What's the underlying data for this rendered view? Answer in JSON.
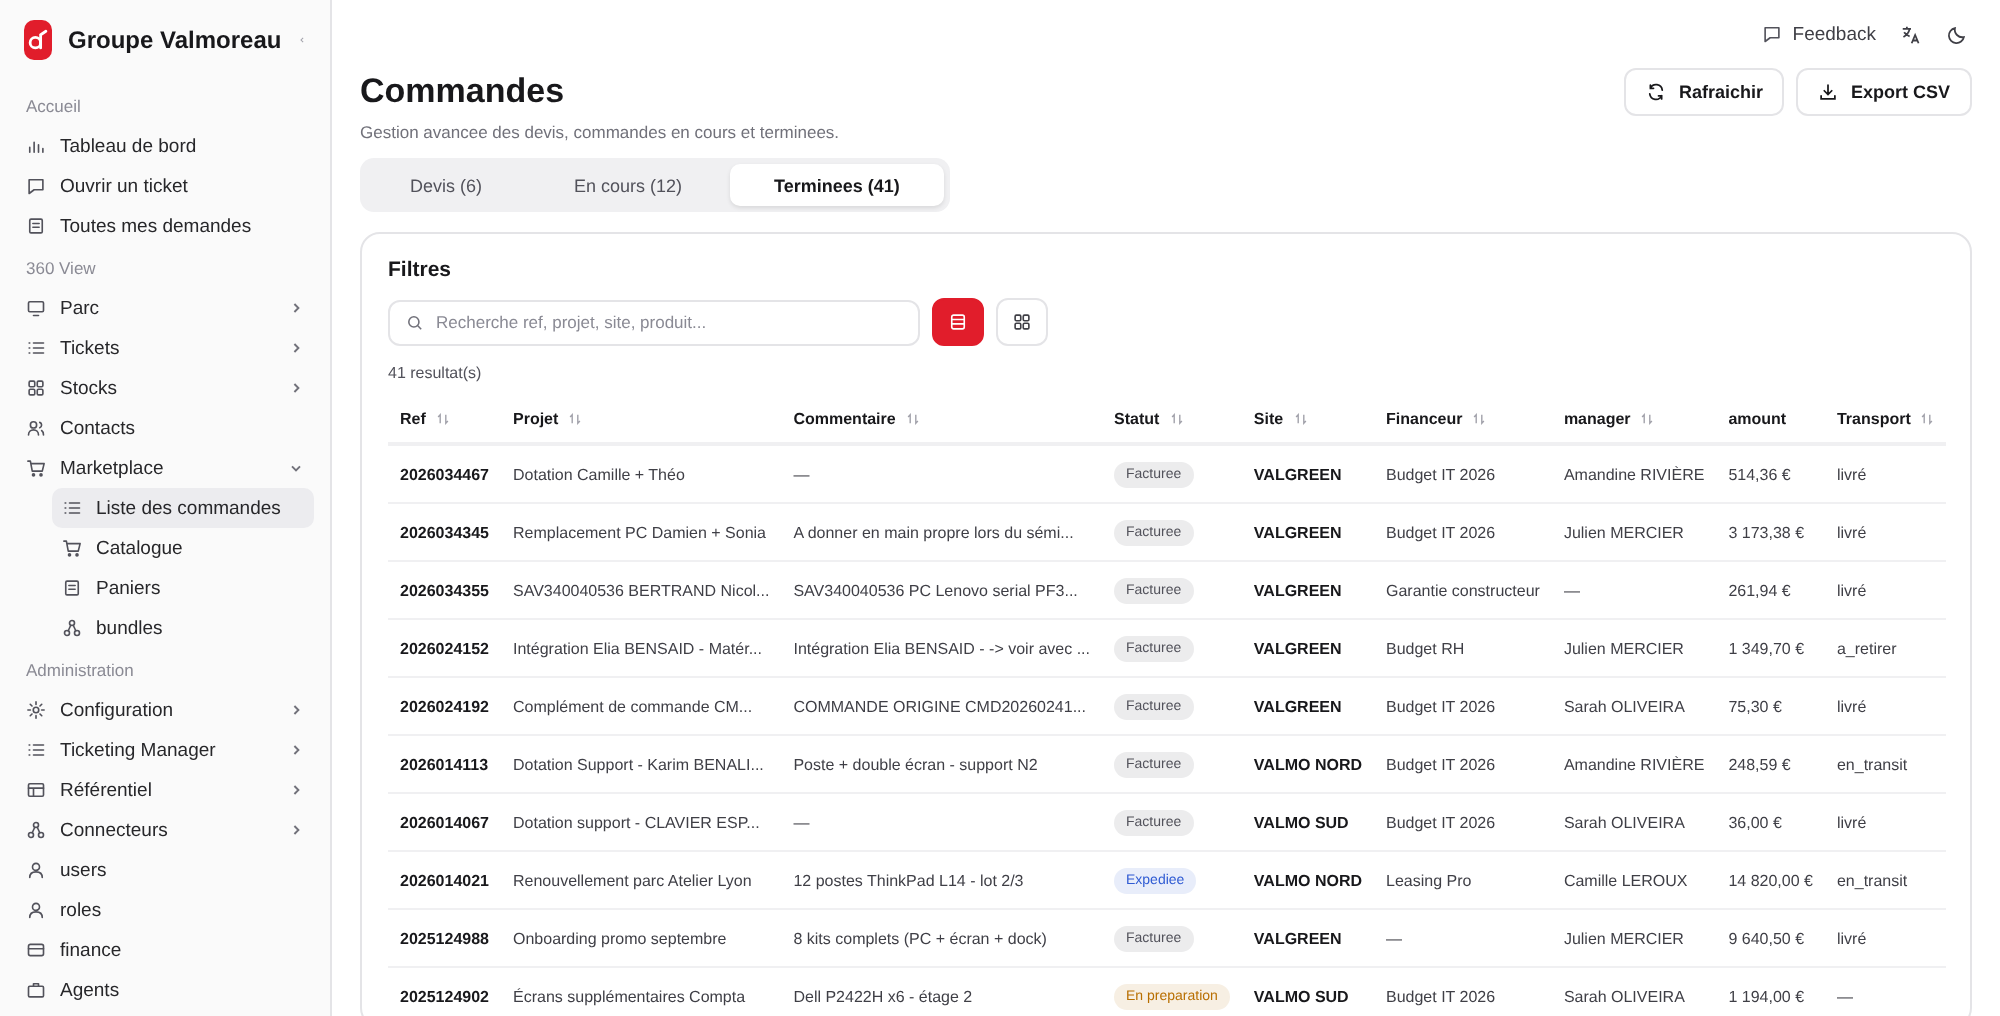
{
  "sidebar": {
    "brand": "Groupe Valmoreau",
    "sections": [
      {
        "title": "Accueil",
        "items": [
          {
            "label": "Tableau de bord",
            "kind": "chart",
            "selected": false
          },
          {
            "label": "Ouvrir un ticket",
            "kind": "message",
            "selected": false
          },
          {
            "label": "Toutes mes demandes",
            "kind": "doc",
            "selected": false
          }
        ]
      },
      {
        "title": "360 View",
        "items": [
          {
            "label": "Parc",
            "kind": "monitor",
            "selected": false,
            "expanded": false
          },
          {
            "label": "Tickets",
            "kind": "list",
            "selected": false,
            "expanded": false
          },
          {
            "label": "Stocks",
            "kind": "grid",
            "selected": false,
            "expanded": false
          },
          {
            "label": "Contacts",
            "kind": "users",
            "selected": false
          },
          {
            "label": "Marketplace",
            "kind": "cart",
            "selected": false,
            "expanded": true,
            "children": [
              {
                "label": "Liste des commandes",
                "kind": "list",
                "selected": true
              },
              {
                "label": "Catalogue",
                "kind": "cart",
                "selected": false
              },
              {
                "label": "Paniers",
                "kind": "doc",
                "selected": false
              },
              {
                "label": "bundles",
                "kind": "nodes",
                "selected": false
              }
            ]
          }
        ]
      },
      {
        "title": "Administration",
        "items": [
          {
            "label": "Configuration",
            "kind": "gear",
            "selected": false,
            "expanded": false
          },
          {
            "label": "Ticketing Manager",
            "kind": "list",
            "selected": false,
            "expanded": false
          },
          {
            "label": "Référentiel",
            "kind": "table",
            "selected": false,
            "expanded": false
          },
          {
            "label": "Connecteurs",
            "kind": "nodes",
            "selected": false,
            "expanded": false
          },
          {
            "label": "users",
            "kind": "user",
            "selected": false
          },
          {
            "label": "roles",
            "kind": "user",
            "selected": false
          },
          {
            "label": "finance",
            "kind": "card",
            "selected": false
          },
          {
            "label": "Agents",
            "kind": "bag",
            "selected": false
          }
        ]
      }
    ]
  },
  "topbar": {
    "feedback": "Feedback"
  },
  "header": {
    "title": "Commandes",
    "subtitle": "Gestion avancee des devis, commandes en cours et terminees.",
    "buttons": [
      {
        "label": "Rafraichir",
        "kind": "refresh"
      },
      {
        "label": "Export CSV",
        "kind": "download"
      }
    ]
  },
  "tabs": [
    {
      "label": "Devis (6)",
      "selected": false
    },
    {
      "label": "En cours (12)",
      "selected": false
    },
    {
      "label": "Terminees (41)",
      "selected": true
    }
  ],
  "filters": {
    "title": "Filtres",
    "search": {
      "placeholder": "Recherche ref, projet, site, produit..."
    },
    "views": [
      {
        "kind": "list",
        "selected": true
      },
      {
        "kind": "grid",
        "selected": false
      }
    ],
    "count": "41 resultat(s)"
  },
  "table": {
    "columns": [
      {
        "label": "Ref",
        "sortable": true
      },
      {
        "label": "Projet",
        "sortable": true
      },
      {
        "label": "Commentaire",
        "sortable": true
      },
      {
        "label": "Statut",
        "sortable": true
      },
      {
        "label": "Site",
        "sortable": true
      },
      {
        "label": "Financeur",
        "sortable": true
      },
      {
        "label": "manager",
        "sortable": true
      },
      {
        "label": "amount",
        "sortable": false
      },
      {
        "label": "Transport",
        "sortable": true
      }
    ],
    "rows": [
      {
        "ref": "2026034467",
        "projet": "Dotation Camille + Théo",
        "commentaire": "—",
        "statut": {
          "label": "Facturee",
          "color": "#52525b"
        },
        "site": "VALGREEN",
        "financeur": "Budget IT 2026",
        "manager": "Amandine RIVIÈRE",
        "amount": "514,36 €",
        "transport": "livré"
      },
      {
        "ref": "2026034345",
        "projet": "Remplacement PC Damien + Sonia",
        "commentaire": "A donner en main propre lors du sémi...",
        "statut": {
          "label": "Facturee",
          "color": "#52525b"
        },
        "site": "VALGREEN",
        "financeur": "Budget IT 2026",
        "manager": "Julien MERCIER",
        "amount": "3 173,38 €",
        "transport": "livré"
      },
      {
        "ref": "2026034355",
        "projet": "SAV340040536 BERTRAND Nicol...",
        "commentaire": "SAV340040536 PC Lenovo serial PF3...",
        "statut": {
          "label": "Facturee",
          "color": "#52525b"
        },
        "site": "VALGREEN",
        "financeur": "Garantie constructeur",
        "manager": "—",
        "amount": "261,94 €",
        "transport": "livré"
      },
      {
        "ref": "2026024152",
        "projet": "Intégration Elia BENSAID - Matér...",
        "commentaire": "Intégration Elia BENSAID - -> voir avec ...",
        "statut": {
          "label": "Facturee",
          "color": "#52525b"
        },
        "site": "VALGREEN",
        "financeur": "Budget RH",
        "manager": "Julien MERCIER",
        "amount": "1 349,70 €",
        "transport": "a_retirer"
      },
      {
        "ref": "2026024192",
        "projet": "Complément de commande CM...",
        "commentaire": "COMMANDE ORIGINE CMD20260241...",
        "statut": {
          "label": "Facturee",
          "color": "#52525b"
        },
        "site": "VALGREEN",
        "financeur": "Budget IT 2026",
        "manager": "Sarah OLIVEIRA",
        "amount": "75,30 €",
        "transport": "livré"
      },
      {
        "ref": "2026014113",
        "projet": "Dotation Support - Karim BENALI...",
        "commentaire": "Poste + double écran - support N2",
        "statut": {
          "label": "Facturee",
          "color": "#52525b"
        },
        "site": "VALMO NORD",
        "financeur": "Budget IT 2026",
        "manager": "Amandine RIVIÈRE",
        "amount": "248,59 €",
        "transport": "en_transit"
      },
      {
        "ref": "2026014067",
        "projet": "Dotation support - CLAVIER ESP...",
        "commentaire": "—",
        "statut": {
          "label": "Facturee",
          "color": "#52525b"
        },
        "site": "VALMO SUD",
        "financeur": "Budget IT 2026",
        "manager": "Sarah OLIVEIRA",
        "amount": "36,00 €",
        "transport": "livré"
      },
      {
        "ref": "2026014021",
        "projet": "Renouvellement parc Atelier Lyon",
        "commentaire": "12 postes ThinkPad L14 - lot 2/3",
        "statut": {
          "label": "Expediee",
          "color": "#2f5bd3"
        },
        "site": "VALMO NORD",
        "financeur": "Leasing Pro",
        "manager": "Camille LEROUX",
        "amount": "14 820,00 €",
        "transport": "en_transit"
      },
      {
        "ref": "2025124988",
        "projet": "Onboarding promo septembre",
        "commentaire": "8 kits complets (PC + écran + dock)",
        "statut": {
          "label": "Facturee",
          "color": "#52525b"
        },
        "site": "VALGREEN",
        "financeur": "—",
        "manager": "Julien MERCIER",
        "amount": "9 640,50 €",
        "transport": "livré"
      },
      {
        "ref": "2025124902",
        "projet": "Écrans supplémentaires Compta",
        "commentaire": "Dell P2422H x6 - étage 2",
        "statut": {
          "label": "En preparation",
          "color": "#b86e00"
        },
        "site": "VALMO SUD",
        "financeur": "Budget IT 2026",
        "manager": "Sarah OLIVEIRA",
        "amount": "1 194,00 €",
        "transport": "—"
      }
    ]
  }
}
